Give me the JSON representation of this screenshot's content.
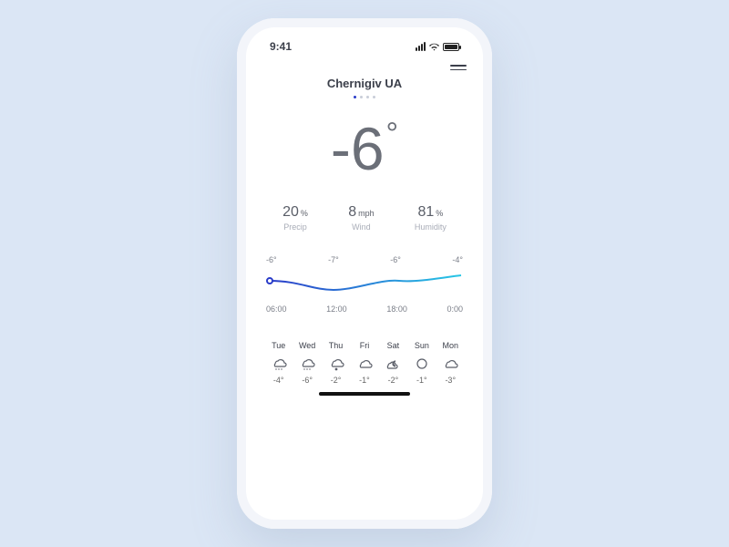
{
  "status": {
    "time": "9:41"
  },
  "location": {
    "name": "Chernigiv UA"
  },
  "current": {
    "temp": "-6",
    "unit": "°"
  },
  "stats": {
    "precip": {
      "value": "20",
      "unit": "%",
      "label": "Precip"
    },
    "wind": {
      "value": "8",
      "unit": "mph",
      "label": "Wind"
    },
    "humidity": {
      "value": "81",
      "unit": "%",
      "label": "Humidity"
    }
  },
  "hourly": {
    "temps": [
      "-6°",
      "-7°",
      "-6°",
      "-4°"
    ],
    "times": [
      "06:00",
      "12:00",
      "18:00",
      "0:00"
    ]
  },
  "daily": [
    {
      "day": "Tue",
      "icon": "snow",
      "temp": "-4°"
    },
    {
      "day": "Wed",
      "icon": "snow",
      "temp": "-6°"
    },
    {
      "day": "Thu",
      "icon": "snow-cloud",
      "temp": "-2°"
    },
    {
      "day": "Fri",
      "icon": "cloud",
      "temp": "-1°"
    },
    {
      "day": "Sat",
      "icon": "moon-cloud",
      "temp": "-2°"
    },
    {
      "day": "Sun",
      "icon": "clear",
      "temp": "-1°"
    },
    {
      "day": "Mon",
      "icon": "cloud",
      "temp": "-3°"
    }
  ],
  "chart_data": {
    "type": "line",
    "x": [
      "06:00",
      "12:00",
      "18:00",
      "0:00"
    ],
    "values": [
      -6,
      -7,
      -6,
      -4
    ],
    "ylim": [
      -8,
      -3
    ],
    "title": "",
    "xlabel": "",
    "ylabel": "",
    "stroke_gradient": [
      "#2a3cc9",
      "#28c7e6"
    ]
  }
}
